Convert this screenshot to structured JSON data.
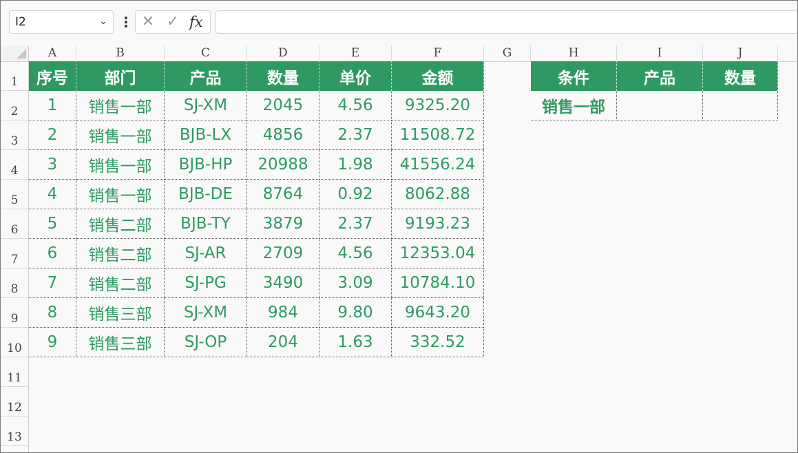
{
  "formula_bar": {
    "name_box": "I2",
    "cancel_icon": "✕",
    "confirm_icon": "✓",
    "fx_label": "fx",
    "formula": ""
  },
  "columns": [
    "A",
    "B",
    "C",
    "D",
    "E",
    "F",
    "G",
    "H",
    "I",
    "J"
  ],
  "rows": [
    "1",
    "2",
    "3",
    "4",
    "5",
    "6",
    "7",
    "8",
    "9",
    "10",
    "11",
    "12",
    "13"
  ],
  "table": {
    "headers": [
      "序号",
      "部门",
      "产品",
      "数量",
      "单价",
      "金额"
    ],
    "rows": [
      [
        "1",
        "销售一部",
        "SJ-XM",
        "2045",
        "4.56",
        "9325.20"
      ],
      [
        "2",
        "销售一部",
        "BJB-LX",
        "4856",
        "2.37",
        "11508.72"
      ],
      [
        "3",
        "销售一部",
        "BJB-HP",
        "20988",
        "1.98",
        "41556.24"
      ],
      [
        "4",
        "销售一部",
        "BJB-DE",
        "8764",
        "0.92",
        "8062.88"
      ],
      [
        "5",
        "销售二部",
        "BJB-TY",
        "3879",
        "2.37",
        "9193.23"
      ],
      [
        "6",
        "销售二部",
        "SJ-AR",
        "2709",
        "4.56",
        "12353.04"
      ],
      [
        "7",
        "销售二部",
        "SJ-PG",
        "3490",
        "3.09",
        "10784.10"
      ],
      [
        "8",
        "销售三部",
        "SJ-XM",
        "984",
        "9.80",
        "9643.20"
      ],
      [
        "9",
        "销售三部",
        "SJ-OP",
        "204",
        "1.63",
        "332.52"
      ]
    ]
  },
  "criteria": {
    "headers": [
      "条件",
      "产品",
      "数量"
    ],
    "values": [
      "销售一部",
      "",
      ""
    ]
  },
  "colors": {
    "header_green": "#2e9a61",
    "text_green": "#2f9a62"
  }
}
